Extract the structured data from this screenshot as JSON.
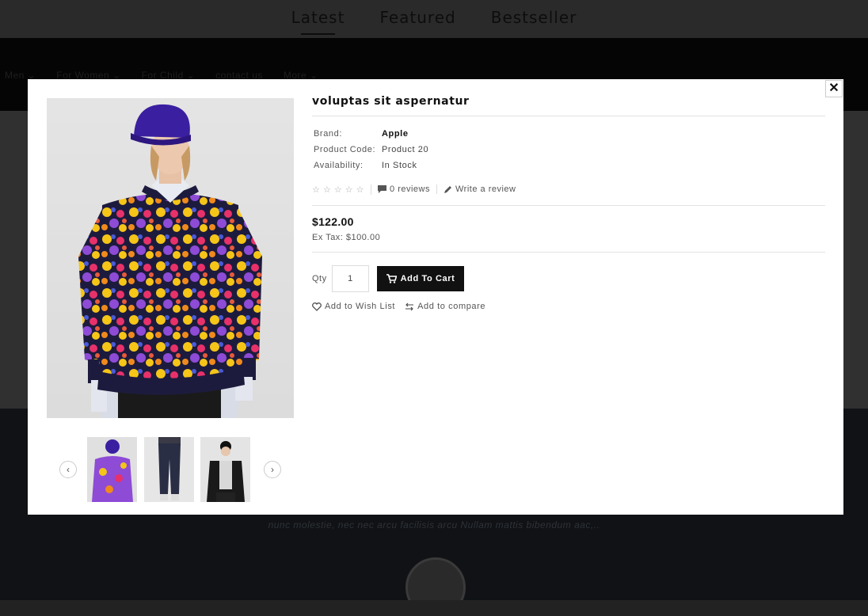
{
  "background": {
    "tabs": [
      "Latest",
      "Featured",
      "Bestseller"
    ],
    "active_tab": "Latest",
    "nav_items": [
      "Men ⌄",
      "For Women ⌄",
      "For Child ⌄",
      "contact us",
      "More ⌄"
    ],
    "quote": "nunc molestie, nec nec arcu facilisis arcu Nullam mattis bibendum aac,.."
  },
  "modal": {
    "close_glyph": "✕",
    "product": {
      "title": "voluptas sit aspernatur",
      "brand_label": "Brand:",
      "brand_value": "Apple",
      "code_label": "Product Code:",
      "code_value": "Product 20",
      "availability_label": "Availability:",
      "availability_value": "In Stock",
      "stars": "☆ ☆ ☆ ☆ ☆",
      "reviews": "0 reviews",
      "write_review": "Write a review",
      "price": "$122.00",
      "ex_tax": "Ex Tax: $100.00",
      "qty_label": "Qty",
      "qty_value": "1",
      "add_to_cart": "Add To Cart",
      "wish_list": "Add to Wish List",
      "compare": "Add to compare"
    },
    "thumbnails": {
      "prev_glyph": "‹",
      "next_glyph": "›",
      "items": [
        "sweater-thumbnail",
        "pants-thumbnail",
        "jacket-thumbnail"
      ]
    },
    "colors": {
      "button": "#111111",
      "hat": "#3a1fa0",
      "sweater_base": "#1a1a3a"
    }
  }
}
